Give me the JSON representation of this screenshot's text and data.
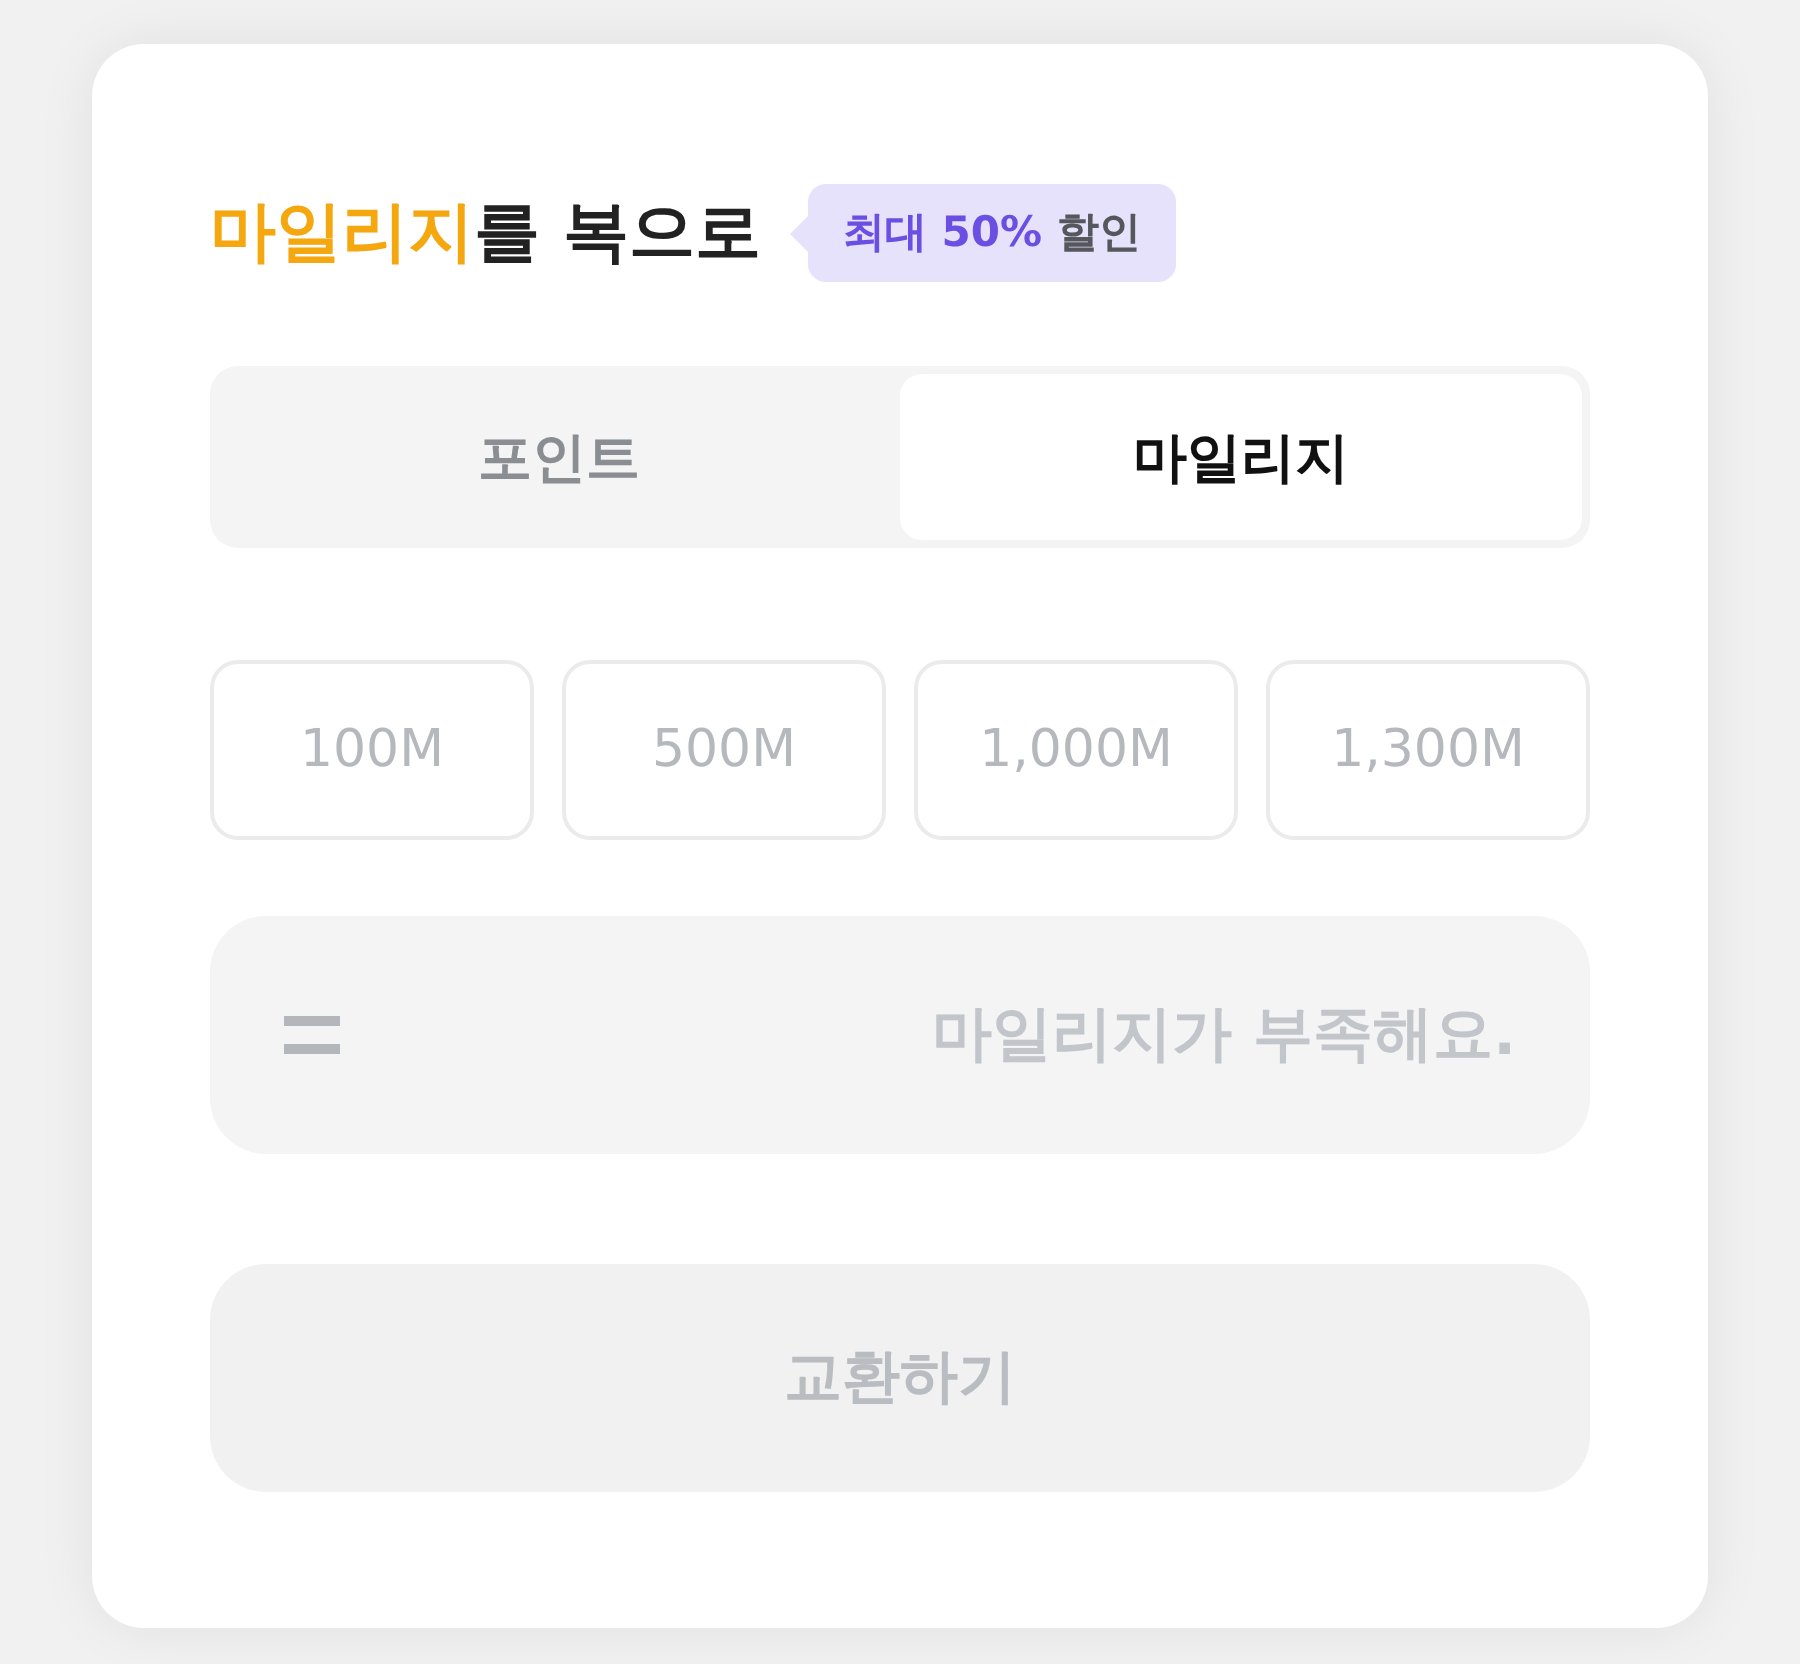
{
  "title": {
    "highlight": "마일리지",
    "rest": "를 복으로"
  },
  "badge": {
    "highlight": "최대 50%",
    "rest": "할인"
  },
  "tabs": [
    {
      "label": "포인트",
      "selected": false
    },
    {
      "label": "마일리지",
      "selected": true
    }
  ],
  "amounts": [
    {
      "label": "100M",
      "selected": false
    },
    {
      "label": "500M",
      "selected": false
    },
    {
      "label": "1,000M",
      "selected": false
    },
    {
      "label": "1,300M",
      "selected": false
    }
  ],
  "result": {
    "message": "마일리지가 부족해요."
  },
  "exchange_button": {
    "label": "교환하기",
    "disabled": true
  }
}
